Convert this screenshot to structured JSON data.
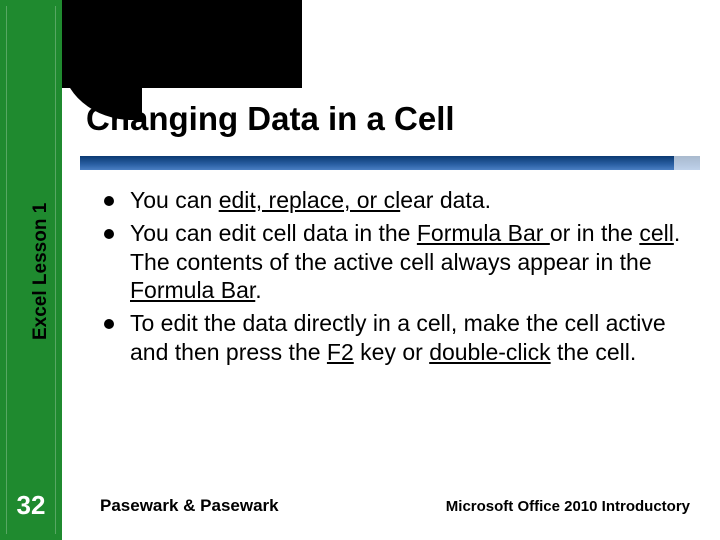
{
  "colors": {
    "green": "#1f8a2f",
    "blue_bar": "#0a3a72"
  },
  "sidebar": {
    "label": "Excel Lesson 1",
    "page_number": "32"
  },
  "title": "Changing Data in a Cell",
  "bullets": [
    {
      "segments": [
        {
          "text": "You can "
        },
        {
          "text": "edit, replace, or cl",
          "underline": true
        },
        {
          "text": "ear data."
        }
      ]
    },
    {
      "segments": [
        {
          "text": "You can edit cell data in the "
        },
        {
          "text": "Formula Bar ",
          "underline": true
        },
        {
          "text": "or in the "
        },
        {
          "text": "cell",
          "underline": true
        },
        {
          "text": ". The contents of the active cell always appear in the "
        },
        {
          "text": "Formula Bar",
          "underline": true
        },
        {
          "text": "."
        }
      ]
    },
    {
      "segments": [
        {
          "text": "To edit the data directly in a cell, make the cell active and then press the "
        },
        {
          "text": "F2",
          "underline": true
        },
        {
          "text": " key or "
        },
        {
          "text": "double-click",
          "underline": true
        },
        {
          "text": " the cell."
        }
      ]
    }
  ],
  "footer": {
    "left": "Pasewark & Pasewark",
    "right": "Microsoft Office 2010 Introductory"
  }
}
